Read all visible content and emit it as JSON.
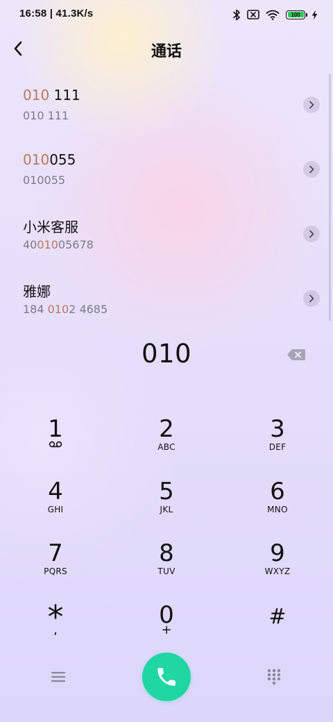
{
  "status_bar": {
    "time": "16:58",
    "network_speed": "41.3K/s",
    "battery_level": "100",
    "icons": [
      "bluetooth-icon",
      "sim-off-icon",
      "wifi-icon",
      "battery-icon",
      "charging-icon"
    ],
    "battery_color": "#35c759"
  },
  "header": {
    "title": "通话",
    "back_icon": "chevron-left-icon"
  },
  "search_highlight_color": "#b8785c",
  "results": [
    {
      "name_highlight": "010",
      "name_rest": " 111",
      "number_pre": "",
      "number_highlight": "",
      "number_post": "010 111"
    },
    {
      "name_highlight": "010",
      "name_rest": "055",
      "number_pre": "",
      "number_highlight": "",
      "number_post": "010055"
    },
    {
      "name_highlight": "",
      "name_rest": "小米客服",
      "number_pre": "40",
      "number_highlight": "010",
      "number_post": "05678"
    },
    {
      "name_highlight": "",
      "name_rest": "雅娜",
      "number_pre": "184 ",
      "number_highlight": "010",
      "number_post": "2 4685"
    }
  ],
  "dialer": {
    "input_value": "010",
    "backspace_icon": "backspace-icon"
  },
  "keypad": [
    {
      "digit": "1",
      "letters": "",
      "sub_icon": "voicemail-icon"
    },
    {
      "digit": "2",
      "letters": "ABC"
    },
    {
      "digit": "3",
      "letters": "DEF"
    },
    {
      "digit": "4",
      "letters": "GHI"
    },
    {
      "digit": "5",
      "letters": "JKL"
    },
    {
      "digit": "6",
      "letters": "MNO"
    },
    {
      "digit": "7",
      "letters": "PQRS"
    },
    {
      "digit": "8",
      "letters": "TUV"
    },
    {
      "digit": "9",
      "letters": "WXYZ"
    },
    {
      "digit": "*",
      "letters": ","
    },
    {
      "digit": "0",
      "letters": "+"
    },
    {
      "digit": "#",
      "letters": ""
    }
  ],
  "bottom_bar": {
    "menu_icon": "menu-icon",
    "call_icon": "phone-icon",
    "call_color": "#20d6a2",
    "keypad_icon": "dialpad-icon"
  }
}
